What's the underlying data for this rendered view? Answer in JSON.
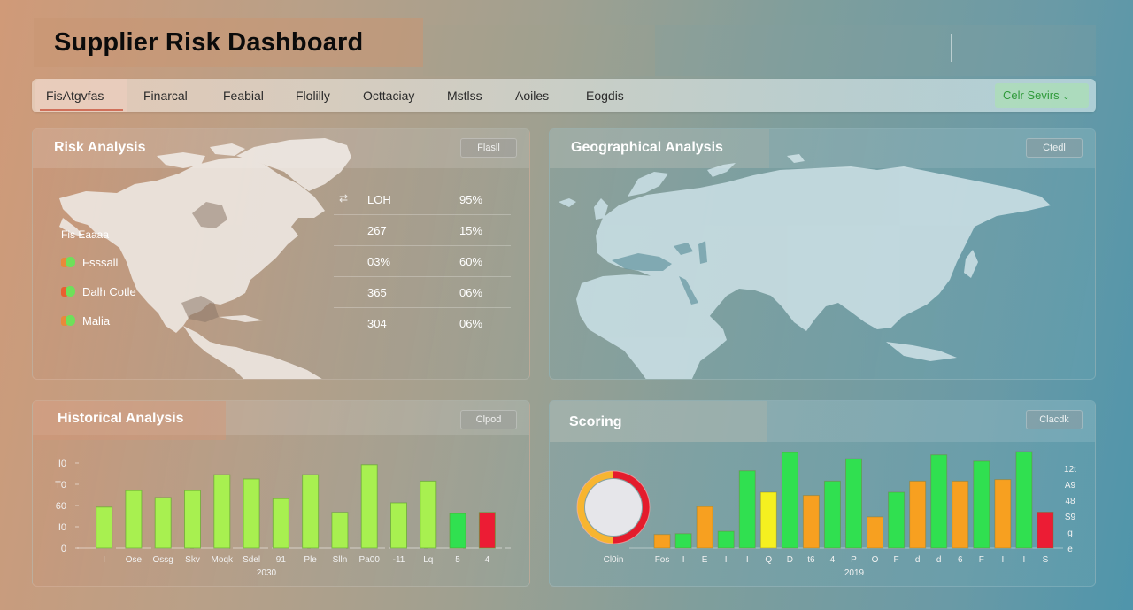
{
  "header": {
    "title": "Supplier Risk Dashboard"
  },
  "tabs": [
    {
      "label": "FisAtgvfas",
      "active": true
    },
    {
      "label": "Finarcal",
      "active": false
    },
    {
      "label": "Feabial",
      "active": false
    },
    {
      "label": "Flolilly",
      "active": false
    },
    {
      "label": "Octtaciay",
      "active": false
    },
    {
      "label": "Mstlss",
      "active": false
    },
    {
      "label": "Aoiles",
      "active": false
    },
    {
      "label": "Eogdis",
      "active": false
    }
  ],
  "filter": {
    "label": "Celr Sevirs",
    "icon": "chevron-down-icon",
    "color": "#2f9a3a"
  },
  "panels": {
    "risk": {
      "title": "Risk Analysis",
      "button": "Flasll",
      "legend_title": "Fis Eaaaa",
      "legend": [
        {
          "label": "Fsssall"
        },
        {
          "label": "Dalh Cotle"
        },
        {
          "label": "Malia"
        }
      ],
      "table": [
        {
          "c1": "LOH",
          "c2": "95%"
        },
        {
          "c1": "267",
          "c2": "15%"
        },
        {
          "c1": "03%",
          "c2": "60%"
        },
        {
          "c1": "365",
          "c2": "06%"
        },
        {
          "c1": "304",
          "c2": "06%"
        }
      ]
    },
    "geo": {
      "title": "Geographical Analysis",
      "button": "Ctedl"
    },
    "hist": {
      "title": "Historical Analysis",
      "button": "Clpod"
    },
    "score": {
      "title": "Scoring",
      "button": "Clacdk"
    }
  },
  "colors": {
    "lime": "#a8f050",
    "green": "#30e050",
    "orange": "#f7a020",
    "yellow": "#f5f020",
    "red": "#ec1c34"
  },
  "chart_data": [
    {
      "type": "bar",
      "title": "Historical Analysis",
      "xlabel": "2030",
      "ylabel": "",
      "ylim": [
        0,
        160
      ],
      "yticks": [
        0,
        40,
        80,
        120,
        160
      ],
      "ytick_labels": [
        "0",
        "I0",
        "60",
        "T0",
        "I0"
      ],
      "categories": [
        "I",
        "Ose",
        "Ossg",
        "Skv",
        "Moqk",
        "Sdel",
        "91",
        "Ple",
        "Slln",
        "Pa00",
        "-11",
        "Lq",
        "5",
        "4"
      ],
      "values": [
        77,
        108,
        95,
        108,
        138,
        130,
        93,
        138,
        67,
        157,
        85,
        126,
        65,
        67
      ],
      "bar_colors": [
        "lime",
        "lime",
        "lime",
        "lime",
        "lime",
        "lime",
        "lime",
        "lime",
        "lime",
        "lime",
        "lime",
        "lime",
        "green",
        "red"
      ],
      "grid": false
    },
    {
      "type": "bar",
      "title": "Scoring",
      "xlabel": "2019",
      "ylabel": "",
      "ylim": [
        0,
        120
      ],
      "yticks": [
        0,
        20,
        40,
        60,
        80,
        100,
        120
      ],
      "ytick_labels": [
        "e",
        "g",
        "S9",
        "48",
        "A9",
        "12t"
      ],
      "categories": [
        "Fos",
        "I",
        "E",
        "I",
        "I",
        "Q",
        "D",
        "t6",
        "4",
        "P",
        "O",
        "F",
        "d",
        "d",
        "6",
        "F",
        "I",
        "I",
        "S"
      ],
      "values": [
        17,
        18,
        52,
        21,
        97,
        70,
        120,
        66,
        84,
        112,
        39,
        70,
        84,
        117,
        84,
        109,
        86,
        121,
        45
      ],
      "bar_colors": [
        "orange",
        "green",
        "orange",
        "green",
        "green",
        "yellow",
        "green",
        "orange",
        "green",
        "green",
        "orange",
        "green",
        "orange",
        "green",
        "orange",
        "green",
        "orange",
        "green",
        "red"
      ],
      "donut": {
        "label": "Cl0in",
        "segments": [
          {
            "name": "orange",
            "fraction": 0.5,
            "color": "#f7b530"
          },
          {
            "name": "red",
            "fraction": 0.5,
            "color": "#e41c2c"
          }
        ]
      },
      "grid": false
    }
  ]
}
